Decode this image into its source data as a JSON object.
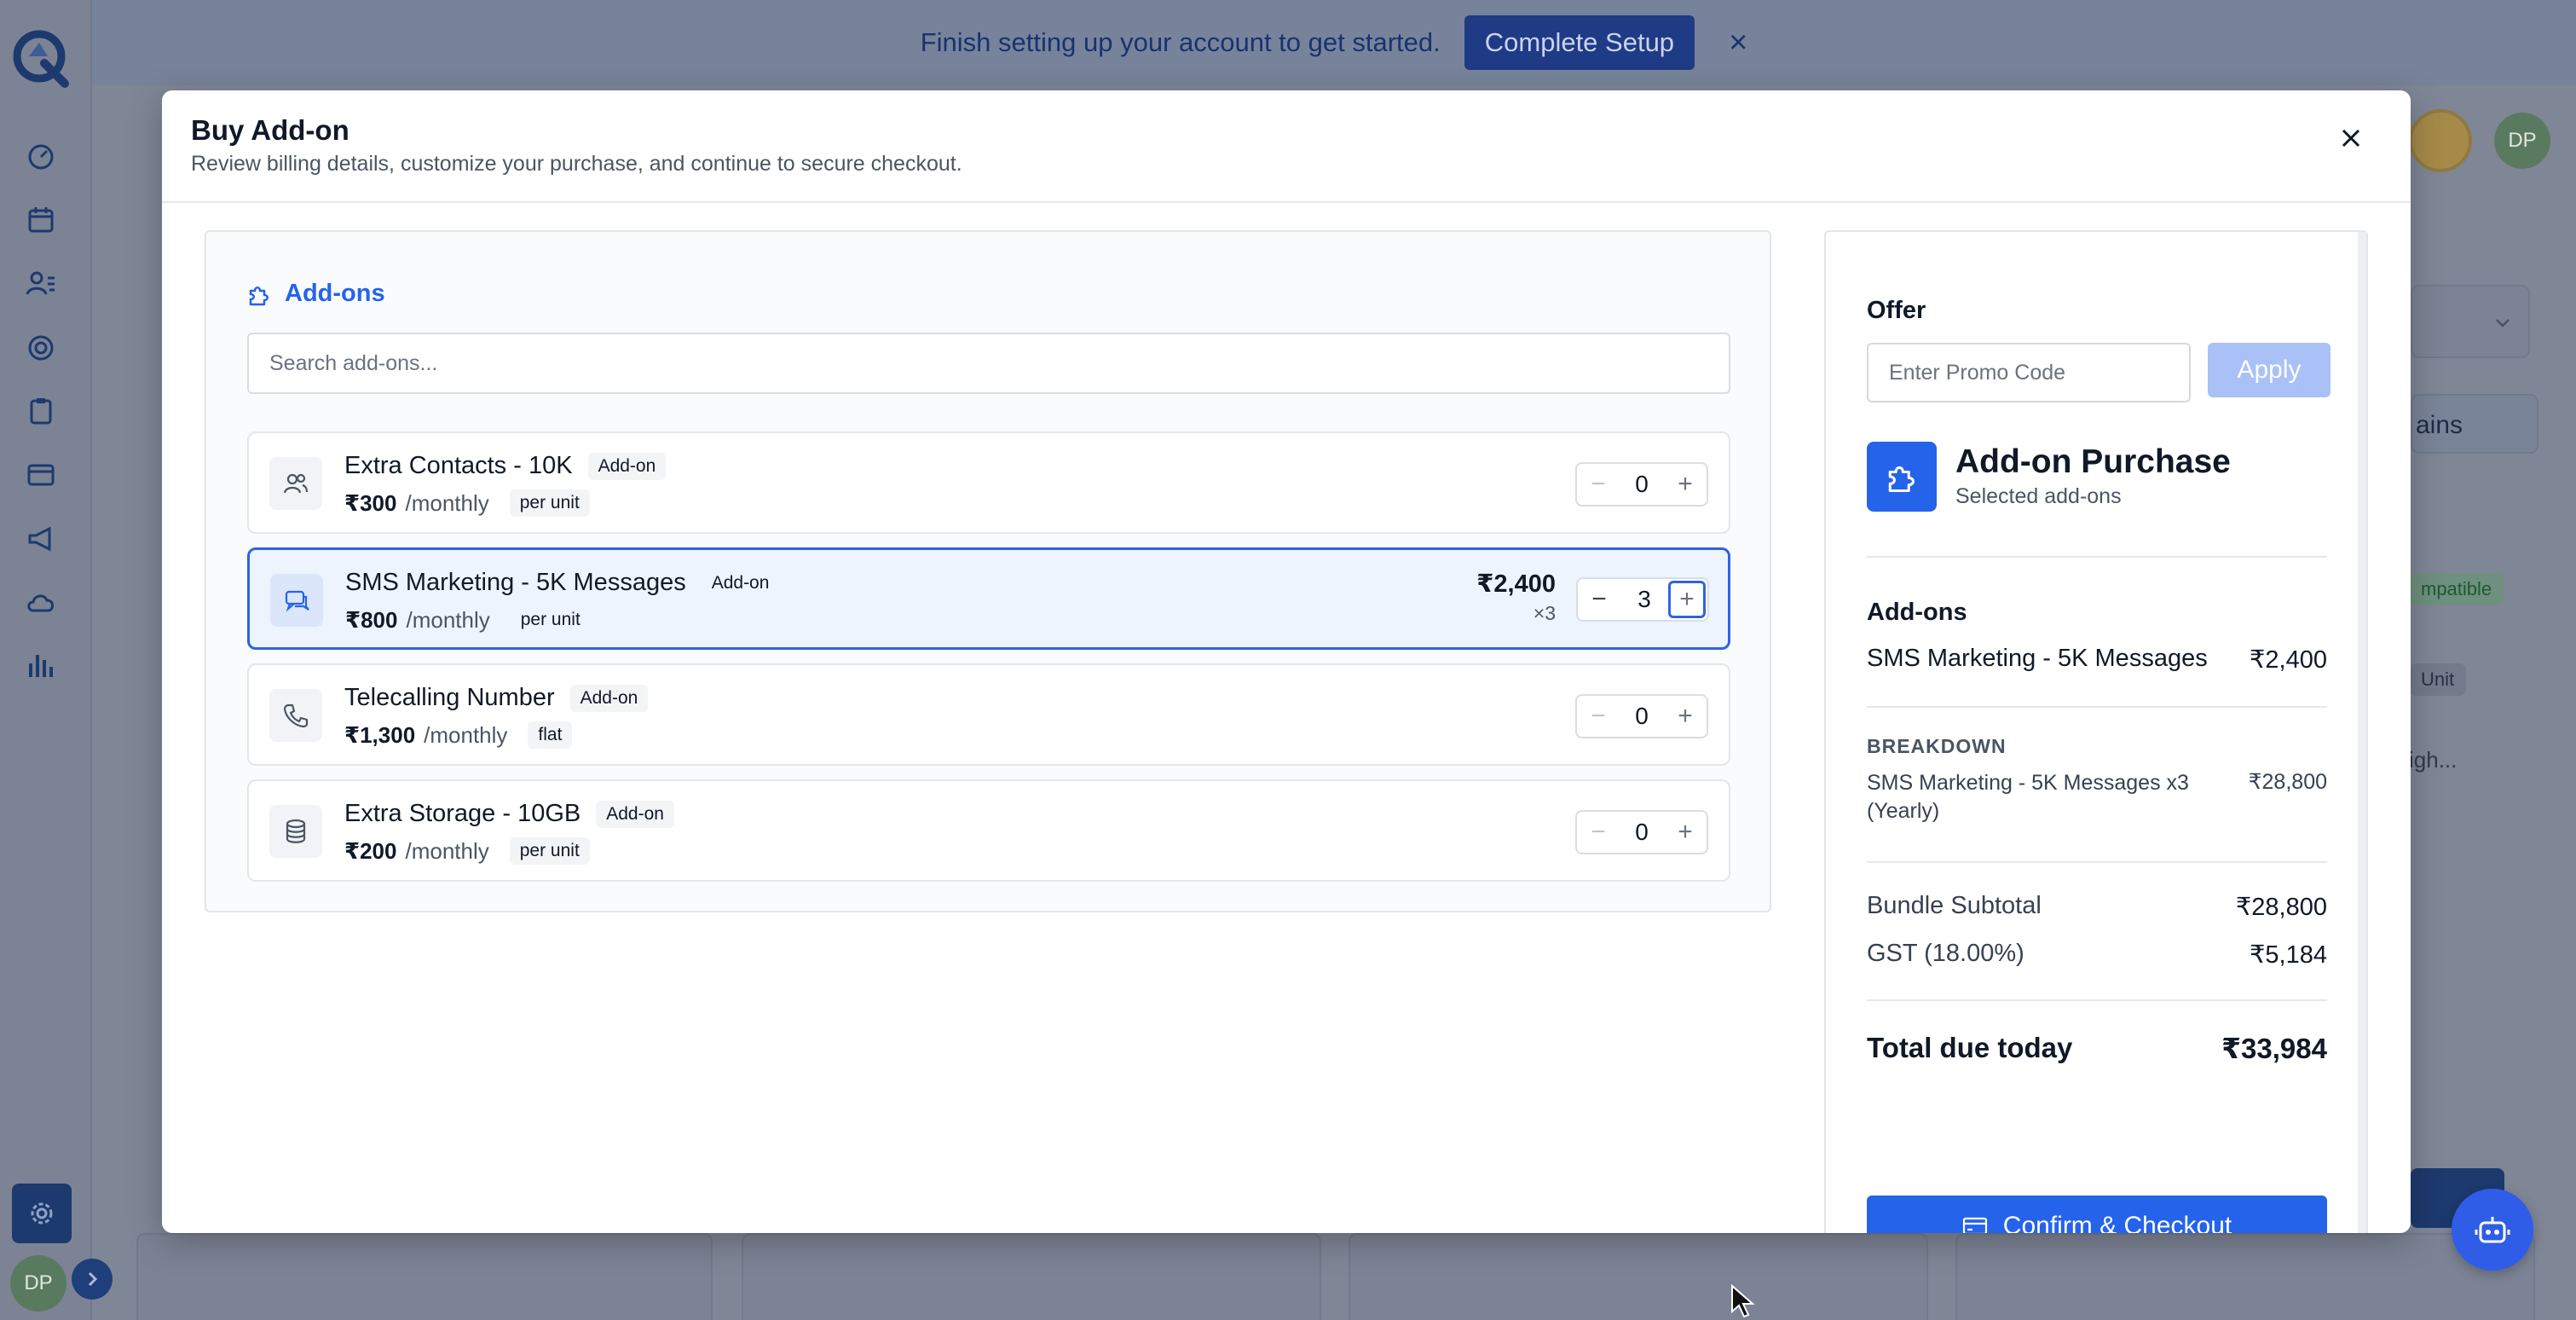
{
  "banner": {
    "text": "Finish setting up your account to get started.",
    "button_label": "Complete Setup"
  },
  "app": {
    "user_initials": "DP",
    "bg_tab_partial": "ains",
    "bg_tag_partial": "mpatible",
    "bg_unit_partial": "Unit",
    "bg_text_partial": "igh..."
  },
  "modal": {
    "title": "Buy Add-on",
    "subtitle": "Review billing details, customize your purchase, and continue to secure checkout."
  },
  "addons": {
    "heading": "Add-ons",
    "search_placeholder": "Search add-ons...",
    "items": [
      {
        "name": "Extra Contacts - 10K",
        "badge": "Add-on",
        "price": "₹300",
        "period": "/monthly",
        "unit": "per unit",
        "quantity": "0",
        "icon": "users-icon"
      },
      {
        "name": "SMS Marketing - 5K Messages",
        "badge": "Add-on",
        "price": "₹800",
        "period": "/monthly",
        "unit": "per unit",
        "quantity": "3",
        "total": "₹2,400",
        "multiplier": "×3",
        "icon": "chat-icon"
      },
      {
        "name": "Telecalling Number",
        "badge": "Add-on",
        "price": "₹1,300",
        "period": "/monthly",
        "unit": "flat",
        "quantity": "0",
        "icon": "phone-icon"
      },
      {
        "name": "Extra Storage - 10GB",
        "badge": "Add-on",
        "price": "₹200",
        "period": "/monthly",
        "unit": "per unit",
        "quantity": "0",
        "icon": "database-icon"
      }
    ]
  },
  "summary": {
    "offer_label": "Offer",
    "promo_placeholder": "Enter Promo Code",
    "apply_label": "Apply",
    "purchase_title": "Add-on Purchase",
    "purchase_subtitle": "Selected add-ons",
    "addons_title": "Add-ons",
    "addon_line_name": "SMS Marketing - 5K Messages",
    "addon_line_amount": "₹2,400",
    "breakdown_label": "BREAKDOWN",
    "breakdown_name": "SMS Marketing - 5K Messages x3 (Yearly)",
    "breakdown_amount": "₹28,800",
    "subtotal_label": "Bundle Subtotal",
    "subtotal_amount": "₹28,800",
    "gst_label": "GST (18.00%)",
    "gst_amount": "₹5,184",
    "total_label": "Total due today",
    "total_amount": "₹33,984",
    "checkout_label": "Confirm & Checkout"
  },
  "colors": {
    "accent": "#2563eb",
    "selected_border": "#2f63e3",
    "apply_disabled": "#a9c1f6"
  }
}
